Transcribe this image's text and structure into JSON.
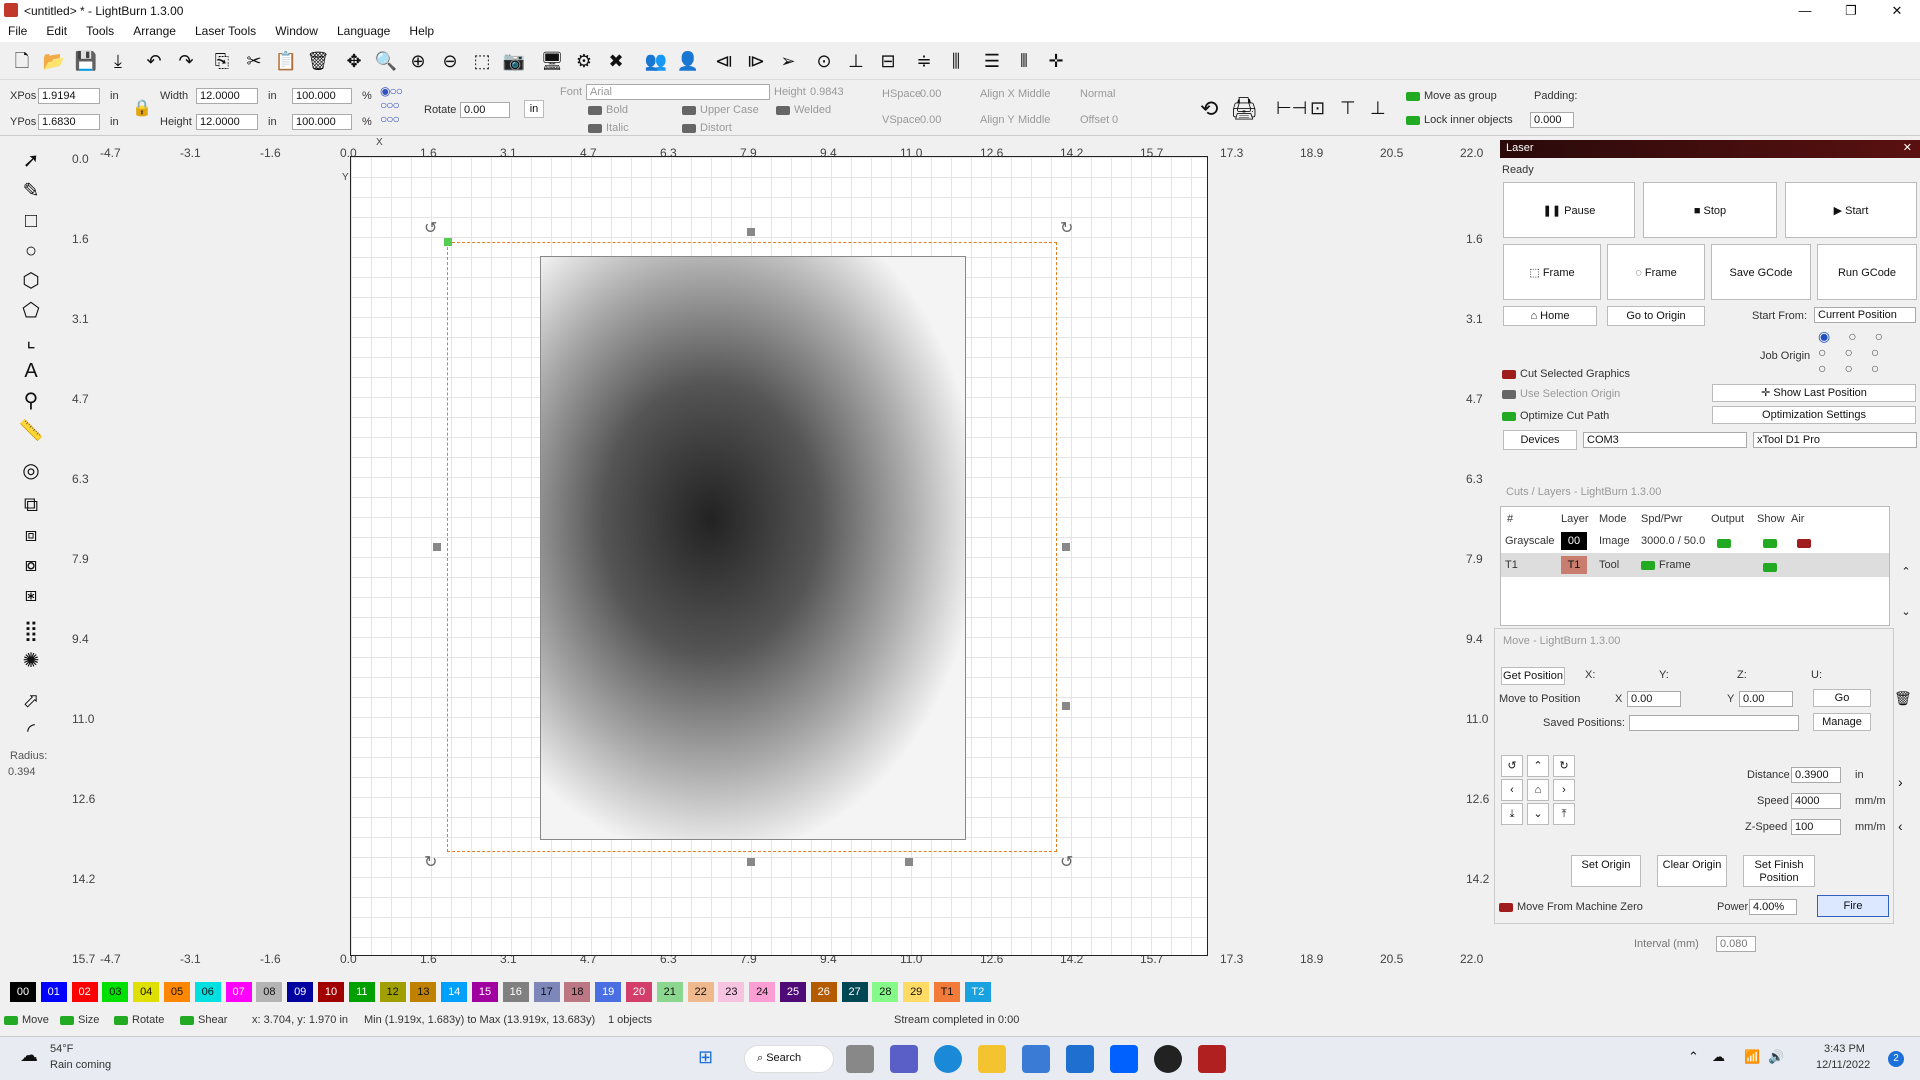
{
  "window": {
    "title": "<untitled> * - LightBurn 1.3.00",
    "minimize": "—",
    "maximize": "❐",
    "close": "✕"
  },
  "menu": [
    "File",
    "Edit",
    "Tools",
    "Arrange",
    "Laser Tools",
    "Window",
    "Language",
    "Help"
  ],
  "props": {
    "xpos_label": "XPos",
    "xpos": "1.9194",
    "ypos_label": "YPos",
    "ypos": "1.6830",
    "unit": "in",
    "width_label": "Width",
    "width": "12.0000",
    "height_label": "Height",
    "height": "12.0000",
    "pct_w": "100.000",
    "pct_h": "100.000",
    "pct": "%",
    "rotate_label": "Rotate",
    "rotate": "0.00",
    "in_btn": "in",
    "font_label": "Font",
    "font": "Arial",
    "font_height_label": "Height",
    "font_height": "0.9843",
    "hspace_label": "HSpace",
    "hspace": "0.00",
    "vspace_label": "VSpace",
    "vspace": "0.00",
    "alignx_label": "Align X",
    "alignx": "Middle",
    "aligny_label": "Align Y",
    "aligny": "Middle",
    "normal": "Normal",
    "offset_label": "Offset",
    "offset": "0",
    "bold": "Bold",
    "italic": "Italic",
    "upper": "Upper Case",
    "distort": "Distort",
    "welded": "Welded",
    "move_group": "Move as group",
    "lock_inner": "Lock inner objects",
    "padding_label": "Padding:",
    "padding": "0.000"
  },
  "ruler": {
    "top": [
      "-4.7",
      "-3.1",
      "-1.6",
      "0.0",
      "1.6",
      "3.1",
      "4.7",
      "6.3",
      "7.9",
      "9.4",
      "11.0",
      "12.6",
      "14.2",
      "15.7",
      "17.3",
      "18.9",
      "20.5",
      "22.0"
    ],
    "left": [
      "0.0",
      "1.6",
      "3.1",
      "4.7",
      "6.3",
      "7.9",
      "9.4",
      "11.0",
      "12.6",
      "14.2",
      "15.7"
    ],
    "right": [
      "1.6",
      "3.1",
      "4.7",
      "6.3",
      "7.9",
      "9.4",
      "11.0",
      "12.6",
      "14.2"
    ],
    "bottom": [
      "-4.7",
      "-3.1",
      "-1.6",
      "0.0",
      "1.6",
      "3.1",
      "4.7",
      "6.3",
      "7.9",
      "9.4",
      "11.0",
      "12.6",
      "14.2",
      "15.7",
      "17.3",
      "18.9",
      "20.5",
      "22.0"
    ],
    "x_marker": "X",
    "y_marker": "Y"
  },
  "left_tools": {
    "radius_label": "Radius:",
    "radius": "0.394"
  },
  "laser": {
    "title": "Laser",
    "status": "Ready",
    "pause": "Pause",
    "stop": "Stop",
    "start": "Start",
    "frame1": "Frame",
    "frame2": "Frame",
    "save_gcode": "Save GCode",
    "run_gcode": "Run GCode",
    "home": "Home",
    "go_origin": "Go to Origin",
    "start_from_label": "Start From:",
    "start_from": "Current Position",
    "job_origin": "Job Origin",
    "cut_selected": "Cut Selected Graphics",
    "use_sel_origin": "Use Selection Origin",
    "show_last": "Show Last Position",
    "optimize": "Optimize Cut Path",
    "opt_settings": "Optimization Settings",
    "devices": "Devices",
    "port": "COM3",
    "device": "xTool D1 Pro"
  },
  "cuts": {
    "title": "Cuts / Layers - LightBurn 1.3.00",
    "headers": [
      "#",
      "Layer",
      "Mode",
      "Spd/Pwr",
      "Output",
      "Show",
      "Air"
    ],
    "rows": [
      {
        "name": "Grayscale",
        "layer": "00",
        "mode": "Image",
        "spd": "3000.0 / 50.0",
        "color": "#000000"
      },
      {
        "name": "T1",
        "layer": "T1",
        "mode": "Tool",
        "spd": "Frame",
        "color": "#c87d6e"
      }
    ]
  },
  "move": {
    "title": "Move - LightBurn 1.3.00",
    "get_position": "Get Position",
    "x_label": "X:",
    "y_label": "Y:",
    "z_label": "Z:",
    "u_label": "U:",
    "move_to": "Move to Position",
    "mx_label": "X",
    "mx": "0.00",
    "my_label": "Y",
    "my": "0.00",
    "go": "Go",
    "saved_label": "Saved Positions:",
    "manage": "Manage",
    "distance_label": "Distance",
    "distance": "0.3900",
    "distance_unit": "in",
    "speed_label": "Speed",
    "speed": "4000",
    "speed_unit": "mm/m",
    "zspeed_label": "Z-Speed",
    "zspeed": "100",
    "zspeed_unit": "mm/m",
    "set_origin": "Set Origin",
    "clear_origin": "Clear Origin",
    "set_finish": "Set Finish Position",
    "machine_zero": "Move From Machine Zero",
    "power_label": "Power",
    "power": "4.00%",
    "fire": "Fire",
    "interval_label": "Interval (mm)",
    "interval": "0.080"
  },
  "palette": [
    {
      "l": "00",
      "c": "#000000",
      "t": "#fff"
    },
    {
      "l": "01",
      "c": "#0000ff",
      "t": "#fff"
    },
    {
      "l": "02",
      "c": "#ff0000",
      "t": "#fff"
    },
    {
      "l": "03",
      "c": "#00e000",
      "t": "#111"
    },
    {
      "l": "04",
      "c": "#e0e000",
      "t": "#111"
    },
    {
      "l": "05",
      "c": "#ff8800",
      "t": "#111"
    },
    {
      "l": "06",
      "c": "#00e0e0",
      "t": "#111"
    },
    {
      "l": "07",
      "c": "#ff00ff",
      "t": "#fff"
    },
    {
      "l": "08",
      "c": "#b4b4b4",
      "t": "#111"
    },
    {
      "l": "09",
      "c": "#0000a0",
      "t": "#fff"
    },
    {
      "l": "10",
      "c": "#a00000",
      "t": "#fff"
    },
    {
      "l": "11",
      "c": "#00a000",
      "t": "#fff"
    },
    {
      "l": "12",
      "c": "#a0a000",
      "t": "#111"
    },
    {
      "l": "13",
      "c": "#c08000",
      "t": "#111"
    },
    {
      "l": "14",
      "c": "#00a0ff",
      "t": "#fff"
    },
    {
      "l": "15",
      "c": "#a000a0",
      "t": "#fff"
    },
    {
      "l": "16",
      "c": "#808080",
      "t": "#fff"
    },
    {
      "l": "17",
      "c": "#7d87b9",
      "t": "#111"
    },
    {
      "l": "18",
      "c": "#bb7784",
      "t": "#111"
    },
    {
      "l": "19",
      "c": "#4a6fe3",
      "t": "#fff"
    },
    {
      "l": "20",
      "c": "#d33f6a",
      "t": "#fff"
    },
    {
      "l": "21",
      "c": "#8cd78f",
      "t": "#111"
    },
    {
      "l": "22",
      "c": "#f0b98d",
      "t": "#111"
    },
    {
      "l": "23",
      "c": "#f6c4e1",
      "t": "#111"
    },
    {
      "l": "24",
      "c": "#fa9ed4",
      "t": "#111"
    },
    {
      "l": "25",
      "c": "#500a78",
      "t": "#fff"
    },
    {
      "l": "26",
      "c": "#b45a00",
      "t": "#fff"
    },
    {
      "l": "27",
      "c": "#004754",
      "t": "#fff"
    },
    {
      "l": "28",
      "c": "#86fa88",
      "t": "#111"
    },
    {
      "l": "29",
      "c": "#ffdb66",
      "t": "#111"
    },
    {
      "l": "T1",
      "c": "#f37b3a",
      "t": "#111"
    },
    {
      "l": "T2",
      "c": "#1aa2e0",
      "t": "#fff"
    }
  ],
  "status": {
    "move": "Move",
    "size": "Size",
    "rotate": "Rotate",
    "shear": "Shear",
    "coords": "x: 3.704, y: 1.970 in",
    "range": "Min (1.919x, 1.683y) to Max (13.919x, 13.683y)",
    "objects": "1 objects",
    "stream": "Stream completed in 0:00"
  },
  "taskbar": {
    "temp": "54°F",
    "weather": "Rain coming",
    "search": "Search",
    "time": "3:43 PM",
    "date": "12/11/2022",
    "badge": "2"
  }
}
